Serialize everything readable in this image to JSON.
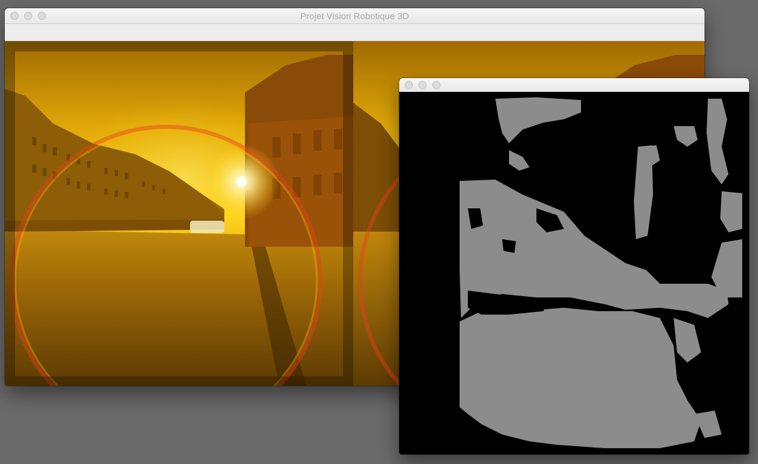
{
  "main_window": {
    "title": "Projet Vision Robotique 3D"
  },
  "depth_window": {
    "title": ""
  },
  "colors": {
    "desktop_background": "#6a6a6a",
    "sky_highlight": "#ffe74a",
    "sky_mid": "#e5ad05",
    "ground_shade": "#8a5805",
    "disparity_gray": "#8c8c8c",
    "disparity_background": "#000000"
  },
  "icons": {
    "close": "close-icon",
    "minimize": "minimize-icon",
    "zoom": "zoom-icon"
  }
}
